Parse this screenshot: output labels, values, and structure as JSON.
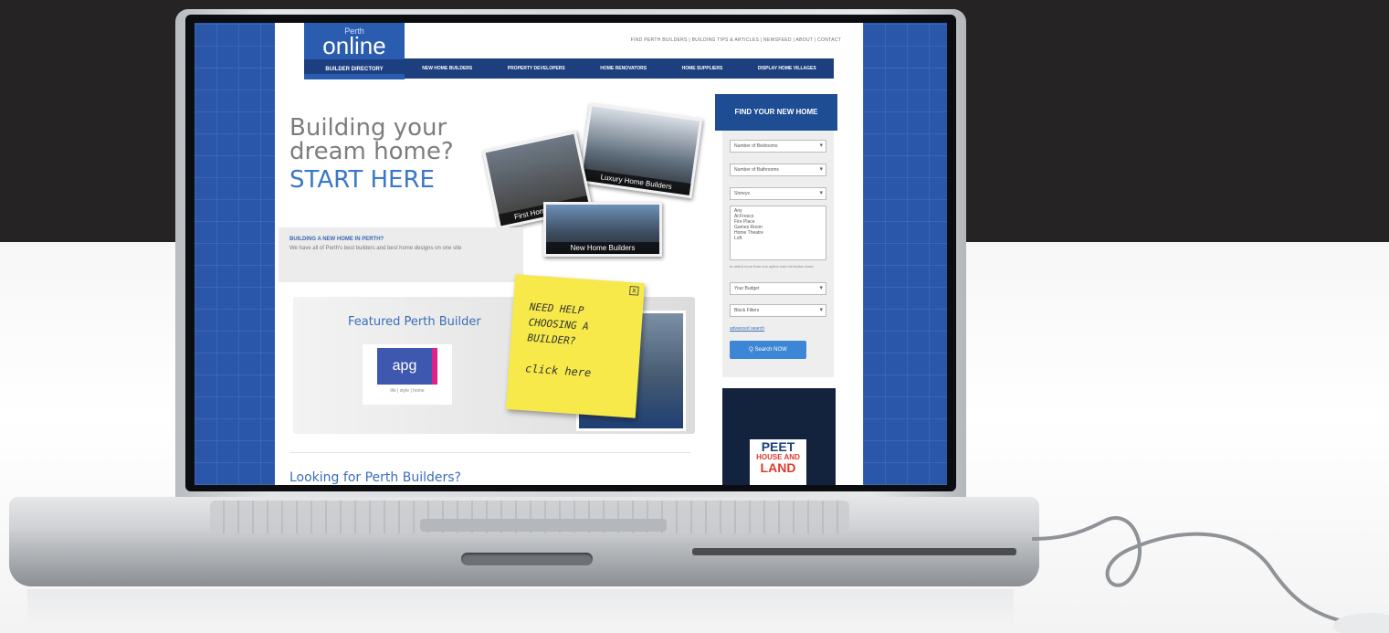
{
  "site": {
    "logo": {
      "city": "Perth",
      "word": "online",
      "sub": "BUILDER DIRECTORY"
    },
    "toplinks": "FIND PERTH BUILDERS | BUILDING TIPS & ARTICLES | NEWSFEED | ABOUT | CONTACT",
    "nav": [
      "NEW HOME BUILDERS",
      "PROPERTY DEVELOPERS",
      "HOME RENOVATORS",
      "HOME SUPPLIERS",
      "DISPLAY HOME VILLAGES"
    ],
    "hero": {
      "line1": "Building your",
      "line2": "dream home?",
      "line3": "START HERE"
    },
    "photos": {
      "first": "First Home Buyers",
      "luxury": "Luxury Home Builders",
      "new": "New Home Builders"
    },
    "about": {
      "heading": "BUILDING A NEW HOME IN PERTH?",
      "text": "We have all of Perth's best builders and best home designs on one site"
    },
    "featured": {
      "title": "Featured Perth Builder",
      "logo": "apg",
      "tagline": "life | style | home"
    },
    "note": {
      "l1": "NEED HELP",
      "l2": "CHOOSING A",
      "l3": "BUILDER?",
      "cta": "click here",
      "close": "x"
    },
    "looking": "Looking for Perth Builders?"
  },
  "search": {
    "heading": "FIND YOUR NEW HOME",
    "bedrooms": "Number of Bedrooms",
    "bathrooms": "Number of Bathrooms",
    "storeys": "Storeys",
    "list": [
      "Any",
      "Al-Fresco",
      "Fire Place",
      "Games Room",
      "Home Theatre",
      "Loft"
    ],
    "hint": "to select more than one option hold ctrl button down",
    "budget": "Your Budget",
    "block": "Block Filters",
    "advanced": "advanced search",
    "button": "Q  Search NOW"
  },
  "ad": {
    "line1": "PEET",
    "line2": "HOUSE AND",
    "line3": "LAND"
  }
}
